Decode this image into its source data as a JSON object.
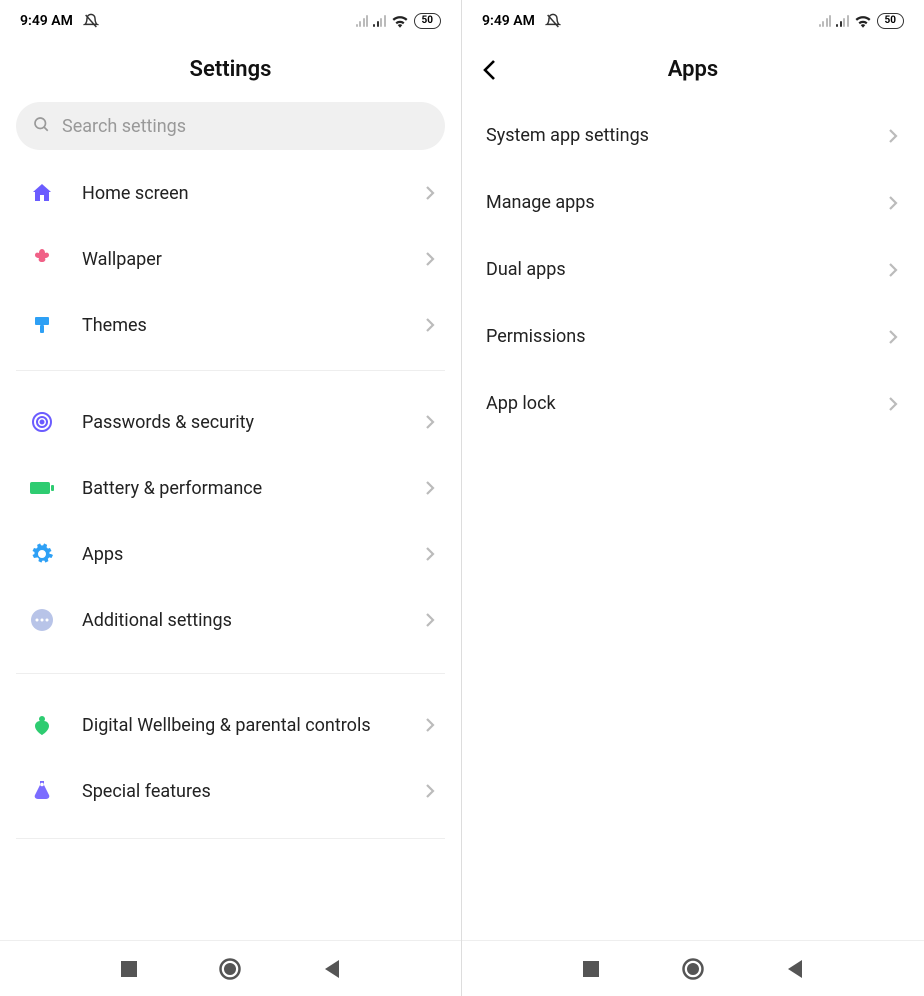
{
  "status": {
    "time": "9:49 AM",
    "battery_text": "50"
  },
  "left": {
    "title": "Settings",
    "search_placeholder": "Search settings",
    "items": [
      {
        "label": "Home screen"
      },
      {
        "label": "Wallpaper"
      },
      {
        "label": "Themes"
      },
      {
        "label": "Passwords & security"
      },
      {
        "label": "Battery & performance"
      },
      {
        "label": "Apps"
      },
      {
        "label": "Additional settings"
      },
      {
        "label": "Digital Wellbeing & parental controls"
      },
      {
        "label": "Special features"
      }
    ]
  },
  "right": {
    "title": "Apps",
    "items": [
      {
        "label": "System app settings"
      },
      {
        "label": "Manage apps"
      },
      {
        "label": "Dual apps"
      },
      {
        "label": "Permissions"
      },
      {
        "label": "App lock"
      }
    ]
  }
}
